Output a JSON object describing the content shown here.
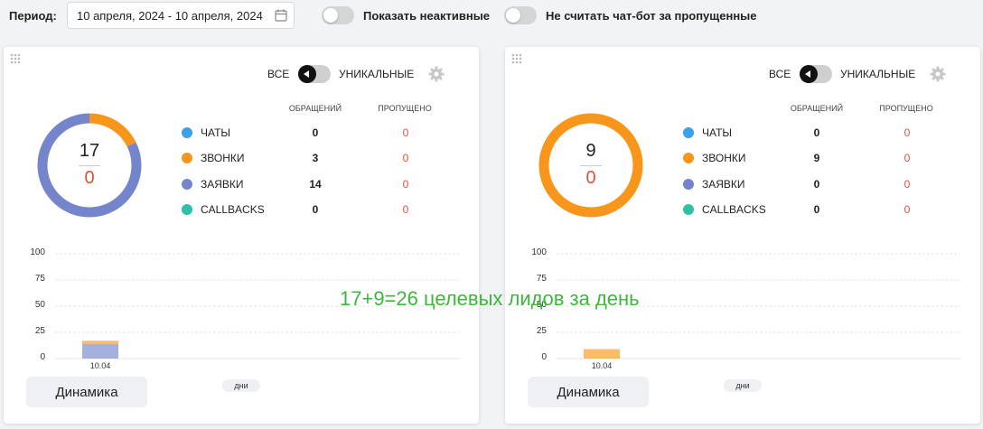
{
  "filters": {
    "period_label": "Период:",
    "date_range": "10 апреля, 2024 - 10 апреля, 2024",
    "show_inactive_label": "Показать неактивные",
    "show_inactive_on": false,
    "chatbot_label": "Не считать чат-бот за пропущенные",
    "chatbot_on": false
  },
  "colors": {
    "chats": "#3aa0e8",
    "calls": "#f7961a",
    "requests": "#7585cc",
    "callbacks": "#2fc0a8",
    "missed": "#e0503c",
    "overlay": "#3cb83c"
  },
  "cards": [
    {
      "mode_all": "ВСЕ",
      "mode_unique": "УНИКАЛЬНЫЕ",
      "total": "17",
      "missed_total": "0",
      "col_requests": "ОБРАЩЕНИЙ",
      "col_missed": "ПРОПУЩЕНО",
      "rows": [
        {
          "name": "ЧАТЫ",
          "count": "0",
          "missed": "0",
          "color_key": "chats"
        },
        {
          "name": "ЗВОНКИ",
          "count": "3",
          "missed": "0",
          "color_key": "calls"
        },
        {
          "name": "ЗАЯВКИ",
          "count": "14",
          "missed": "0",
          "color_key": "requests"
        },
        {
          "name": "CALLBACKS",
          "count": "0",
          "missed": "0",
          "color_key": "callbacks"
        }
      ],
      "chart_data": {
        "type": "bar",
        "categories": [
          "10.04"
        ],
        "series": [
          {
            "name": "ЗАЯВКИ",
            "values": [
              14
            ]
          },
          {
            "name": "ЗВОНКИ",
            "values": [
              3
            ]
          }
        ],
        "yticks": [
          "100",
          "75",
          "50",
          "25",
          "0"
        ],
        "ylim": [
          0,
          100
        ],
        "stacked": true,
        "grid": true
      },
      "dynamics_label": "Динамика",
      "days_label": "дни"
    },
    {
      "mode_all": "ВСЕ",
      "mode_unique": "УНИКАЛЬНЫЕ",
      "total": "9",
      "missed_total": "0",
      "col_requests": "ОБРАЩЕНИЙ",
      "col_missed": "ПРОПУЩЕНО",
      "rows": [
        {
          "name": "ЧАТЫ",
          "count": "0",
          "missed": "0",
          "color_key": "chats"
        },
        {
          "name": "ЗВОНКИ",
          "count": "9",
          "missed": "0",
          "color_key": "calls"
        },
        {
          "name": "ЗАЯВКИ",
          "count": "0",
          "missed": "0",
          "color_key": "requests"
        },
        {
          "name": "CALLBACKS",
          "count": "0",
          "missed": "0",
          "color_key": "callbacks"
        }
      ],
      "chart_data": {
        "type": "bar",
        "categories": [
          "10.04"
        ],
        "series": [
          {
            "name": "ЗАЯВКИ",
            "values": [
              0
            ]
          },
          {
            "name": "ЗВОНКИ",
            "values": [
              9
            ]
          }
        ],
        "yticks": [
          "100",
          "75",
          "50",
          "25",
          "0"
        ],
        "ylim": [
          0,
          100
        ],
        "stacked": true,
        "grid": true
      },
      "dynamics_label": "Динамика",
      "days_label": "дни"
    }
  ],
  "overlay_text": "17+9=26 целевых лидов за день"
}
